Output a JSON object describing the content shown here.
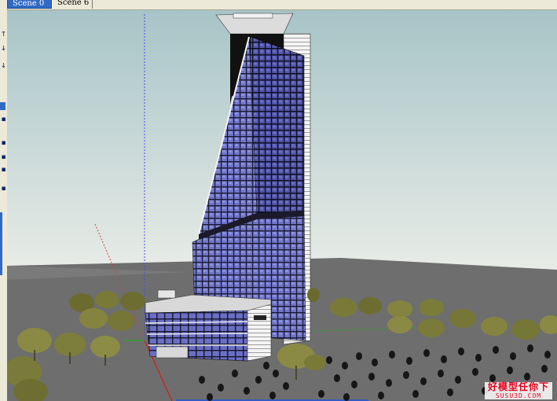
{
  "scene_tabs": [
    {
      "label": "Scene 0",
      "active": true
    },
    {
      "label": "Scene 6",
      "active": false
    }
  ],
  "watermark": {
    "title": "好模型任你下",
    "subtitle": "SUSU3D.COM"
  },
  "colors": {
    "sky_top": "#a7c4c7",
    "sky_bottom": "#e6ebe6",
    "ground": "#6e6e6e",
    "glass": "#6f74c8",
    "active_tab": "#316ac5",
    "watermark": "#e8001c"
  }
}
